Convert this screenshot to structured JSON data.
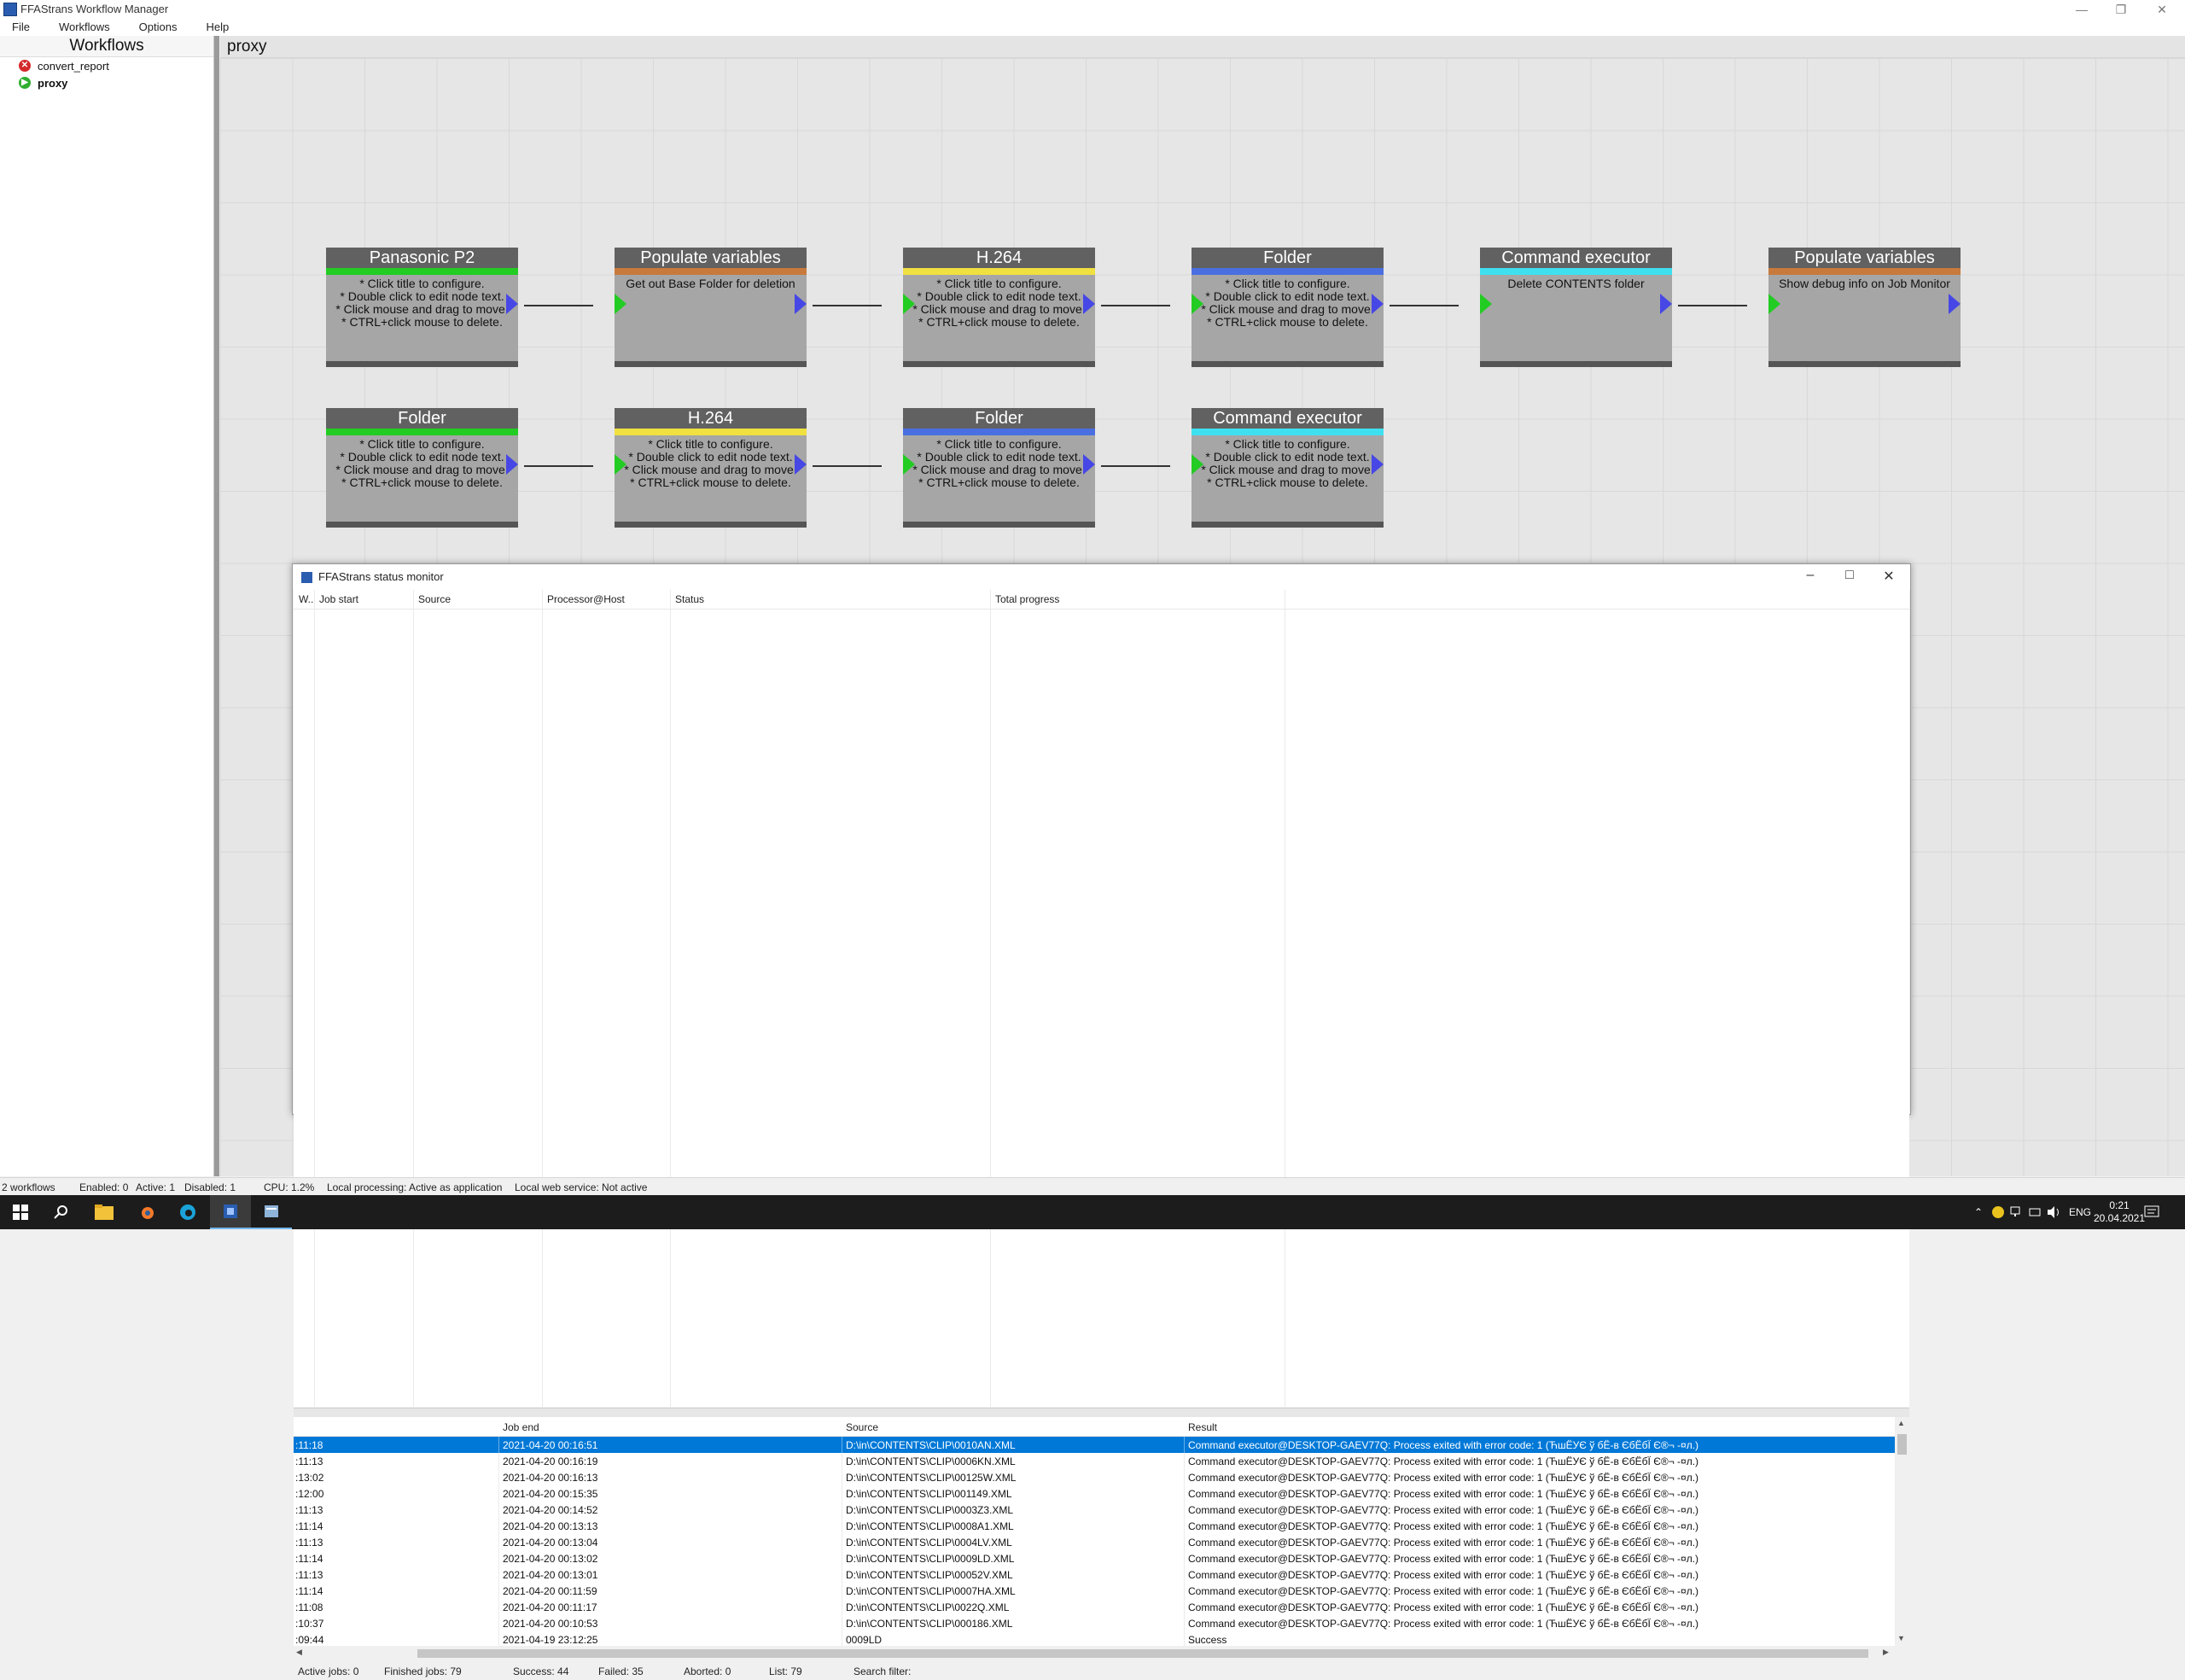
{
  "window": {
    "title": "FFAStrans Workflow Manager"
  },
  "menu": [
    "File",
    "Workflows",
    "Options",
    "Help"
  ],
  "sidebar": {
    "header": "Workflows",
    "items": [
      {
        "label": "convert_report",
        "state": "disabled"
      },
      {
        "label": "proxy",
        "state": "active"
      }
    ]
  },
  "canvas": {
    "title": "proxy",
    "nodes": [
      {
        "title": "Panasonic P2",
        "color": "#22cc22",
        "body": "* Click title to configure.\n* Double click to edit node text.\n* Click mouse and drag to move.\n* CTRL+click mouse to delete."
      },
      {
        "title": "Populate variables",
        "color": "#c87a3c",
        "body": "Get out Base Folder for deletion"
      },
      {
        "title": "H.264",
        "color": "#f0e040",
        "body": "* Click title to configure.\n* Double click to edit node text.\n* Click mouse and drag to move.\n* CTRL+click mouse to delete."
      },
      {
        "title": "Folder",
        "color": "#4a6fe0",
        "body": "* Click title to configure.\n* Double click to edit node text.\n* Click mouse and drag to move.\n* CTRL+click mouse to delete."
      },
      {
        "title": "Command executor",
        "color": "#3ee0f0",
        "body": "Delete CONTENTS folder"
      },
      {
        "title": "Populate variables",
        "color": "#c87a3c",
        "body": "Show debug info on Job Monitor"
      },
      {
        "title": "Folder",
        "color": "#22cc22",
        "body": "* Click title to configure.\n* Double click to edit node text.\n* Click mouse and drag to move.\n* CTRL+click mouse to delete."
      },
      {
        "title": "H.264",
        "color": "#f0e040",
        "body": "* Click title to configure.\n* Double click to edit node text.\n* Click mouse and drag to move.\n* CTRL+click mouse to delete."
      },
      {
        "title": "Folder",
        "color": "#4a6fe0",
        "body": "* Click title to configure.\n* Double click to edit node text.\n* Click mouse and drag to move.\n* CTRL+click mouse to delete."
      },
      {
        "title": "Command executor",
        "color": "#3ee0f0",
        "body": "* Click title to configure.\n* Double click to edit node text.\n* Click mouse and drag to move.\n* CTRL+click mouse to delete."
      }
    ]
  },
  "monitor": {
    "title": "FFAStrans status monitor",
    "active_columns": [
      "W..",
      "Job start",
      "Source",
      "Processor@Host",
      "Status",
      "Total progress"
    ],
    "finished_columns": [
      "",
      "Job end",
      "Source",
      "Result"
    ],
    "rows": [
      {
        "start": ":11:18",
        "end": "2021-04-20 00:16:51",
        "source": "D:\\in\\CONTENTS\\CLIP\\0010AN.XML",
        "result": "Command executor@DESKTOP-GAEV77Q: Process exited with error code: 1 (ЋшЁУЄ ў бЁ-в ЄбЁбЇ Є®¬ -¤л.)"
      },
      {
        "start": ":11:13",
        "end": "2021-04-20 00:16:19",
        "source": "D:\\in\\CONTENTS\\CLIP\\0006KN.XML",
        "result": "Command executor@DESKTOP-GAEV77Q: Process exited with error code: 1 (ЋшЁУЄ ў бЁ-в ЄбЁбЇ Є®¬ -¤л.)"
      },
      {
        "start": ":13:02",
        "end": "2021-04-20 00:16:13",
        "source": "D:\\in\\CONTENTS\\CLIP\\00125W.XML",
        "result": "Command executor@DESKTOP-GAEV77Q: Process exited with error code: 1 (ЋшЁУЄ ў бЁ-в ЄбЁбЇ Є®¬ -¤л.)"
      },
      {
        "start": ":12:00",
        "end": "2021-04-20 00:15:35",
        "source": "D:\\in\\CONTENTS\\CLIP\\001149.XML",
        "result": "Command executor@DESKTOP-GAEV77Q: Process exited with error code: 1 (ЋшЁУЄ ў бЁ-в ЄбЁбЇ Є®¬ -¤л.)"
      },
      {
        "start": ":11:13",
        "end": "2021-04-20 00:14:52",
        "source": "D:\\in\\CONTENTS\\CLIP\\0003Z3.XML",
        "result": "Command executor@DESKTOP-GAEV77Q: Process exited with error code: 1 (ЋшЁУЄ ў бЁ-в ЄбЁбЇ Є®¬ -¤л.)"
      },
      {
        "start": ":11:14",
        "end": "2021-04-20 00:13:13",
        "source": "D:\\in\\CONTENTS\\CLIP\\0008A1.XML",
        "result": "Command executor@DESKTOP-GAEV77Q: Process exited with error code: 1 (ЋшЁУЄ ў бЁ-в ЄбЁбЇ Є®¬ -¤л.)"
      },
      {
        "start": ":11:13",
        "end": "2021-04-20 00:13:04",
        "source": "D:\\in\\CONTENTS\\CLIP\\0004LV.XML",
        "result": "Command executor@DESKTOP-GAEV77Q: Process exited with error code: 1 (ЋшЁУЄ ў бЁ-в ЄбЁбЇ Є®¬ -¤л.)"
      },
      {
        "start": ":11:14",
        "end": "2021-04-20 00:13:02",
        "source": "D:\\in\\CONTENTS\\CLIP\\0009LD.XML",
        "result": "Command executor@DESKTOP-GAEV77Q: Process exited with error code: 1 (ЋшЁУЄ ў бЁ-в ЄбЁбЇ Є®¬ -¤л.)"
      },
      {
        "start": ":11:13",
        "end": "2021-04-20 00:13:01",
        "source": "D:\\in\\CONTENTS\\CLIP\\00052V.XML",
        "result": "Command executor@DESKTOP-GAEV77Q: Process exited with error code: 1 (ЋшЁУЄ ў бЁ-в ЄбЁбЇ Є®¬ -¤л.)"
      },
      {
        "start": ":11:14",
        "end": "2021-04-20 00:11:59",
        "source": "D:\\in\\CONTENTS\\CLIP\\0007HA.XML",
        "result": "Command executor@DESKTOP-GAEV77Q: Process exited with error code: 1 (ЋшЁУЄ ў бЁ-в ЄбЁбЇ Є®¬ -¤л.)"
      },
      {
        "start": ":11:08",
        "end": "2021-04-20 00:11:17",
        "source": "D:\\in\\CONTENTS\\CLIP\\0022Q.XML",
        "result": "Command executor@DESKTOP-GAEV77Q: Process exited with error code: 1 (ЋшЁУЄ ў бЁ-в ЄбЁбЇ Є®¬ -¤л.)"
      },
      {
        "start": ":10:37",
        "end": "2021-04-20 00:10:53",
        "source": "D:\\in\\CONTENTS\\CLIP\\000186.XML",
        "result": "Command executor@DESKTOP-GAEV77Q: Process exited with error code: 1 (ЋшЁУЄ ў бЁ-в ЄбЁбЇ Є®¬ -¤л.)"
      },
      {
        "start": ":09:44",
        "end": "2021-04-19 23:12:25",
        "source": "0009LD",
        "result": "Success"
      }
    ],
    "status": {
      "active": "Active jobs: 0",
      "finished": "Finished jobs: 79",
      "success": "Success: 44",
      "failed": "Failed: 35",
      "aborted": "Aborted: 0",
      "list": "List: 79",
      "search": "Search filter:"
    }
  },
  "statusbar": {
    "workflows": "2 workflows",
    "enabled": "Enabled: 0",
    "active": "Active: 1",
    "disabled": "Disabled: 1",
    "cpu": "CPU: 1.2%",
    "local": "Local processing: Active as application",
    "web": "Local web service: Not active"
  },
  "taskbar": {
    "lang": "ENG",
    "time": "0:21",
    "date": "20.04.2021"
  },
  "colors": {
    "selection": "#0078d7",
    "node_title": "#616161",
    "node_body": "#a6a6a6",
    "pin_in": "#22cc22",
    "pin_out": "#4747e6"
  }
}
